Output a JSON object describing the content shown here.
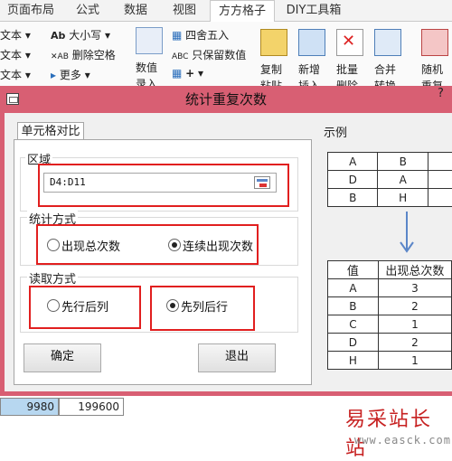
{
  "ribbon": {
    "tabs": [
      "页面布局",
      "公式",
      "数据",
      "视图",
      "方方格子",
      "DIY工具箱"
    ],
    "active_tab": "方方格子",
    "left_items": [
      "文本",
      "文本",
      "文本"
    ],
    "size_label": "大小写",
    "delete_space_label": "删除空格",
    "more_label": "更多",
    "number_label": "数值",
    "number_sub": "录入",
    "round_label": "四舍五入",
    "keep_values_label": "只保留数值",
    "plus_label": "+",
    "copy_label": "复制",
    "copy_sub": "粘贴",
    "add_label": "新增",
    "add_sub": "插入",
    "batch_label": "批量",
    "batch_sub": "删除",
    "merge_label": "合并",
    "merge_sub": "转换",
    "random_label": "随机",
    "random_sub": "重复"
  },
  "dialog": {
    "title": "统计重复次数",
    "help": "?",
    "tab_label": "单元格对比",
    "range_group_label": "区域",
    "range_value": "D4:D11",
    "stat_group_label": "统计方式",
    "stat_options": [
      "出现总次数",
      "连续出现次数"
    ],
    "stat_selected": "连续出现次数",
    "read_group_label": "读取方式",
    "read_options": [
      "先行后列",
      "先列后行"
    ],
    "read_selected": "先列后行",
    "ok_label": "确定",
    "exit_label": "退出",
    "example_label": "示例",
    "example_input": [
      [
        "A",
        "B"
      ],
      [
        "D",
        "A"
      ],
      [
        "B",
        "H"
      ]
    ],
    "example_output_headers": [
      "值",
      "出现总次数"
    ],
    "example_output": [
      [
        "A",
        "3"
      ],
      [
        "B",
        "2"
      ],
      [
        "C",
        "1"
      ],
      [
        "D",
        "2"
      ],
      [
        "H",
        "1"
      ]
    ]
  },
  "sheet": {
    "cell1": "9980",
    "cell2": "199600"
  },
  "watermark": {
    "line1": "易采站长站",
    "line2": "www.easck.com"
  },
  "colors": {
    "dialog_frame": "#d85f73",
    "highlight_box": "#e11f1f"
  }
}
